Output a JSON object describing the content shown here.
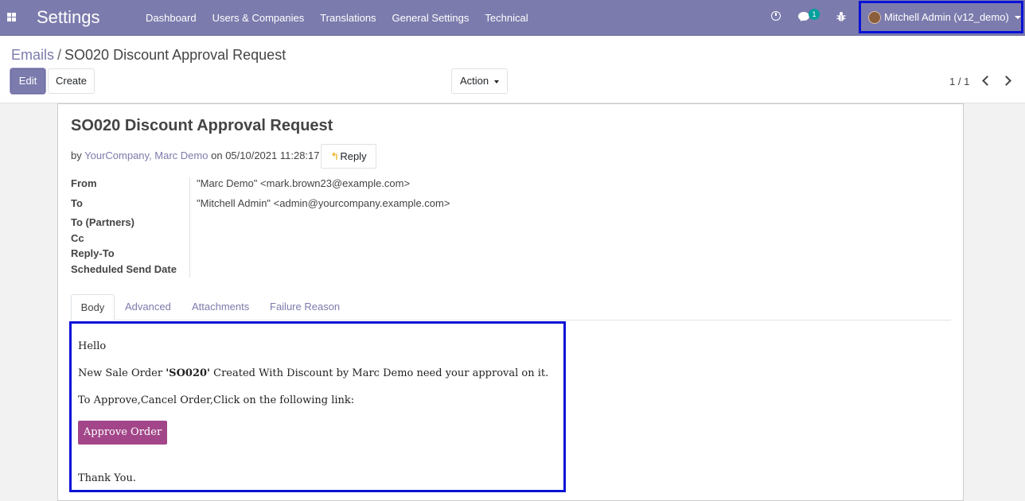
{
  "navbar": {
    "app_title": "Settings",
    "menu": [
      "Dashboard",
      "Users & Companies",
      "Translations",
      "General Settings",
      "Technical"
    ],
    "chat_badge": "1",
    "user": "Mitchell Admin (v12_demo)"
  },
  "breadcrumb": {
    "parent": "Emails",
    "separator": "/",
    "current": "SO020 Discount Approval Request"
  },
  "buttons": {
    "edit": "Edit",
    "create": "Create",
    "action": "Action"
  },
  "pager": {
    "value": "1 / 1"
  },
  "mail": {
    "subject": "SO020 Discount Approval Request",
    "by_prefix": "by",
    "authors": "YourCompany, Marc Demo",
    "on_prefix": "on",
    "date": "05/10/2021 11:28:17",
    "reply": "Reply"
  },
  "fields": [
    {
      "label": "From",
      "value": "\"Marc Demo\" <mark.brown23@example.com>"
    },
    {
      "label": "To",
      "value": "\"Mitchell Admin\" <admin@yourcompany.example.com>"
    },
    {
      "label": "To (Partners)",
      "value": ""
    },
    {
      "label": "Cc",
      "value": ""
    },
    {
      "label": "Reply-To",
      "value": ""
    },
    {
      "label": "Scheduled Send Date",
      "value": ""
    }
  ],
  "tabs": [
    "Body",
    "Advanced",
    "Attachments",
    "Failure Reason"
  ],
  "body": {
    "greeting": "Hello",
    "line1_prefix": "New Sale Order ",
    "line1_order": "'SO020'",
    "line1_suffix": " Created With Discount by Marc Demo need your approval on it.",
    "line2": "To Approve,Cancel Order,Click on the following link:",
    "approve_button": "Approve Order",
    "closing": "Thank You."
  },
  "colors": {
    "navbar": "#7c7bad",
    "approve_button": "#a24689",
    "highlight_border": "#0a12d6",
    "badge": "#00a09d"
  }
}
